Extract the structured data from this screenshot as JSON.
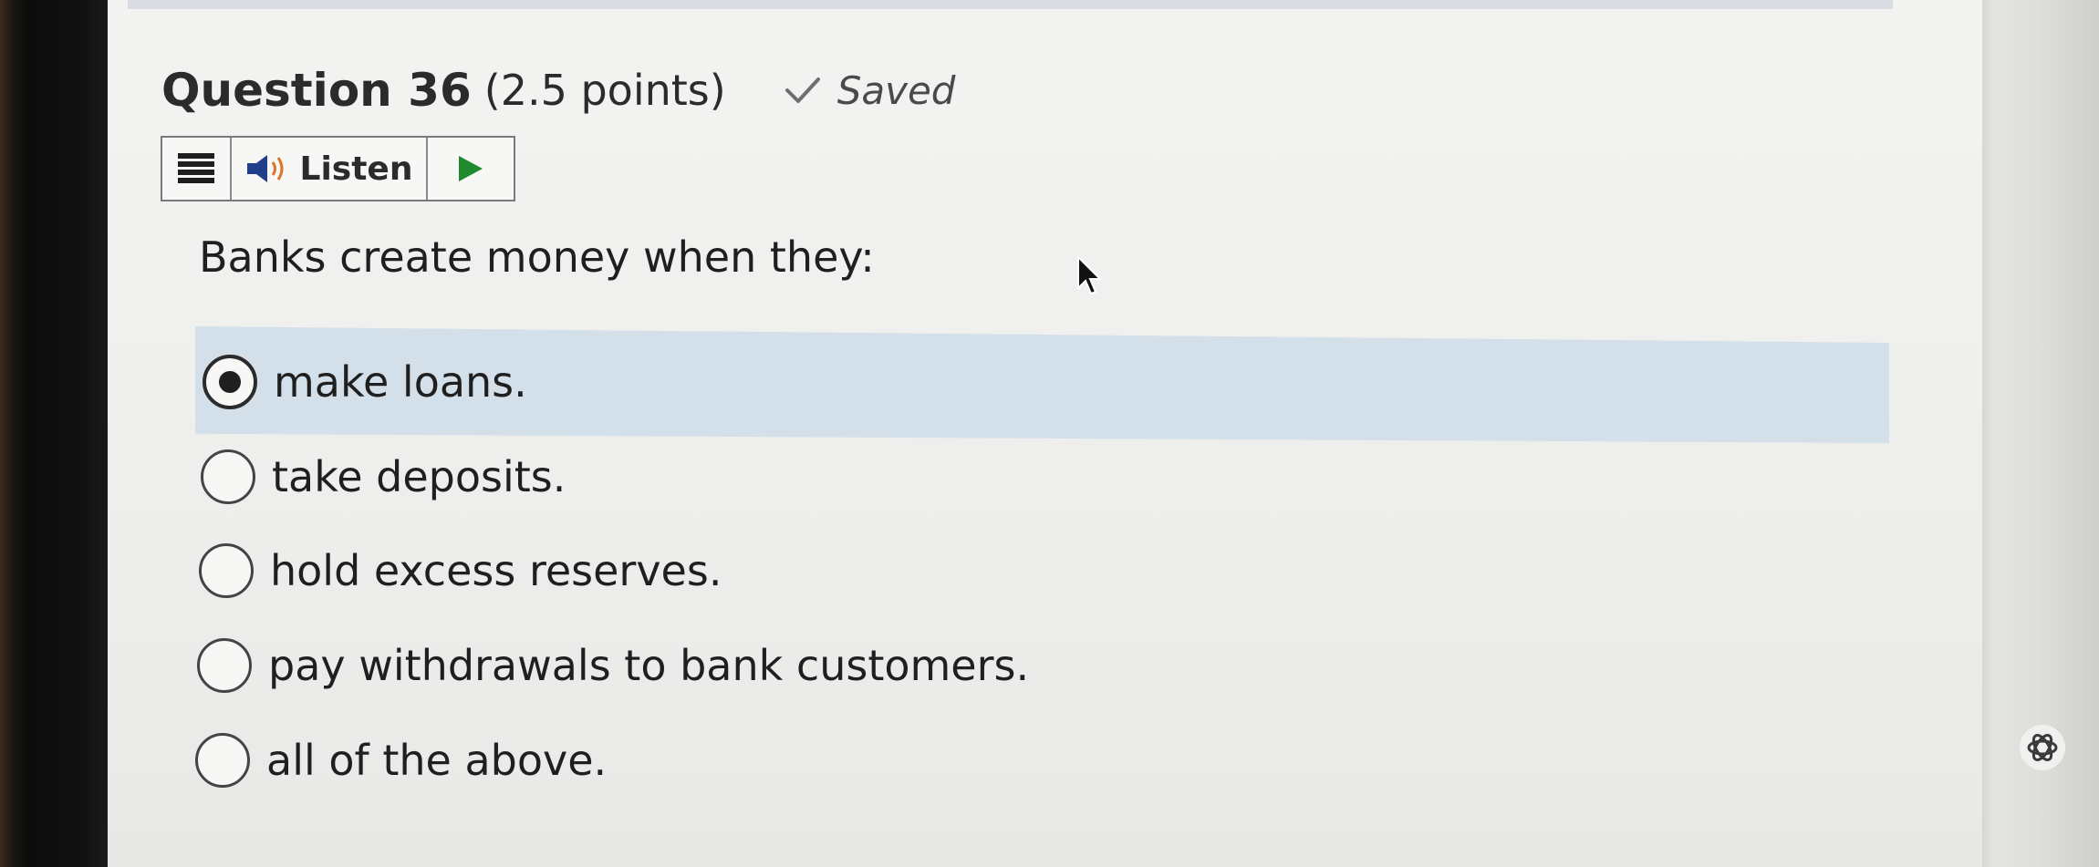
{
  "question": {
    "title": "Question 36",
    "points": "(2.5 points)",
    "status": "Saved",
    "prompt": "Banks create money when they:"
  },
  "toolbar": {
    "menu_icon": "hamburger-menu-icon",
    "listen_label": "Listen",
    "speaker_icon": "speaker-icon",
    "play_icon": "play-icon"
  },
  "options": [
    {
      "label": "make loans.",
      "selected": true
    },
    {
      "label": "take deposits.",
      "selected": false
    },
    {
      "label": "hold excess reserves.",
      "selected": false
    },
    {
      "label": "pay withdrawals to bank customers.",
      "selected": false
    },
    {
      "label": "all of the above.",
      "selected": false
    }
  ],
  "colors": {
    "selected_highlight": "#d4e0e9",
    "play_green": "#1f8a2e",
    "speaker_blue": "#1f3f8a"
  }
}
